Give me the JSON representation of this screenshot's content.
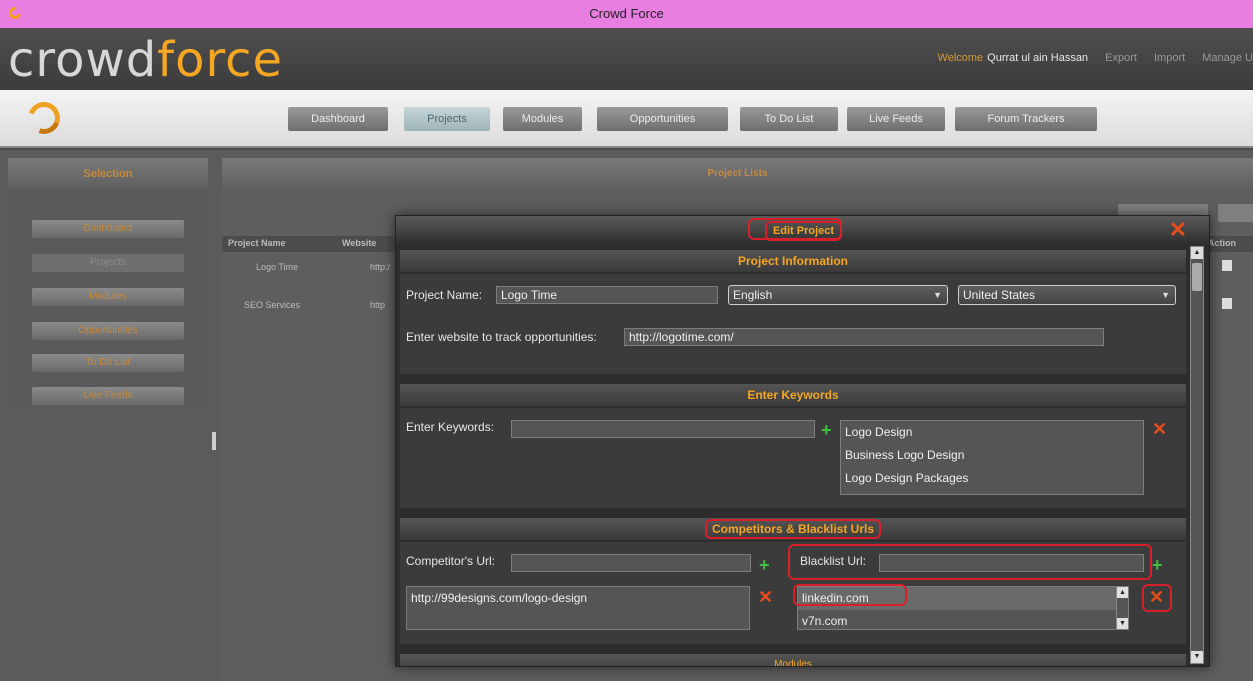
{
  "window": {
    "title": "Crowd Force"
  },
  "header": {
    "logo_a": "cr",
    "logo_o": "o",
    "logo_b": "wd",
    "logo_c": "force",
    "welcome": "Welcome",
    "user": "Qurrat ul ain Hassan",
    "links": [
      "Export",
      "Import",
      "Manage U"
    ]
  },
  "nav": {
    "items": [
      "Dashboard",
      "Projects",
      "Modules",
      "Opportunities",
      "To Do List",
      "Live Feeds",
      "Forum Trackers"
    ],
    "active": "Projects"
  },
  "sidebar": {
    "title": "Selection",
    "items": [
      "Dashboard",
      "Projects",
      "Modules",
      "Opportunities",
      "To Do List",
      "Live Feeds"
    ]
  },
  "content": {
    "title": "Project Lists",
    "columns": [
      "Project Name",
      "Website",
      "Action"
    ],
    "rows": [
      {
        "name": "Logo Time",
        "website": "http:/"
      },
      {
        "name": "SEO Services",
        "website": "http"
      }
    ]
  },
  "modal": {
    "title": "Edit Project",
    "project_info": {
      "heading": "Project Information",
      "name_label": "Project Name:",
      "name_value": "Logo Time",
      "language": "English",
      "country": "United States",
      "website_label": "Enter website to track opportunities:",
      "website_value": "http://logotime.com/"
    },
    "keywords": {
      "heading": "Enter Keywords",
      "label": "Enter Keywords:",
      "input_value": "",
      "list": [
        "Logo Design",
        "Business Logo Design",
        "Logo Design Packages"
      ]
    },
    "competitors": {
      "heading": "Competitors & Blacklist Urls",
      "competitor_label": "Competitor's Url:",
      "competitor_input": "",
      "competitor_list": [
        "http://99designs.com/logo-design"
      ],
      "blacklist_label": "Blacklist Url:",
      "blacklist_input": "",
      "blacklist_list": [
        "linkedin.com",
        "v7n.com"
      ]
    },
    "modules_heading": "Modules"
  },
  "colors": {
    "accent": "#f5a623",
    "highlight": "#d8202a",
    "add": "#3fbf3f",
    "remove": "#e74c1c"
  }
}
